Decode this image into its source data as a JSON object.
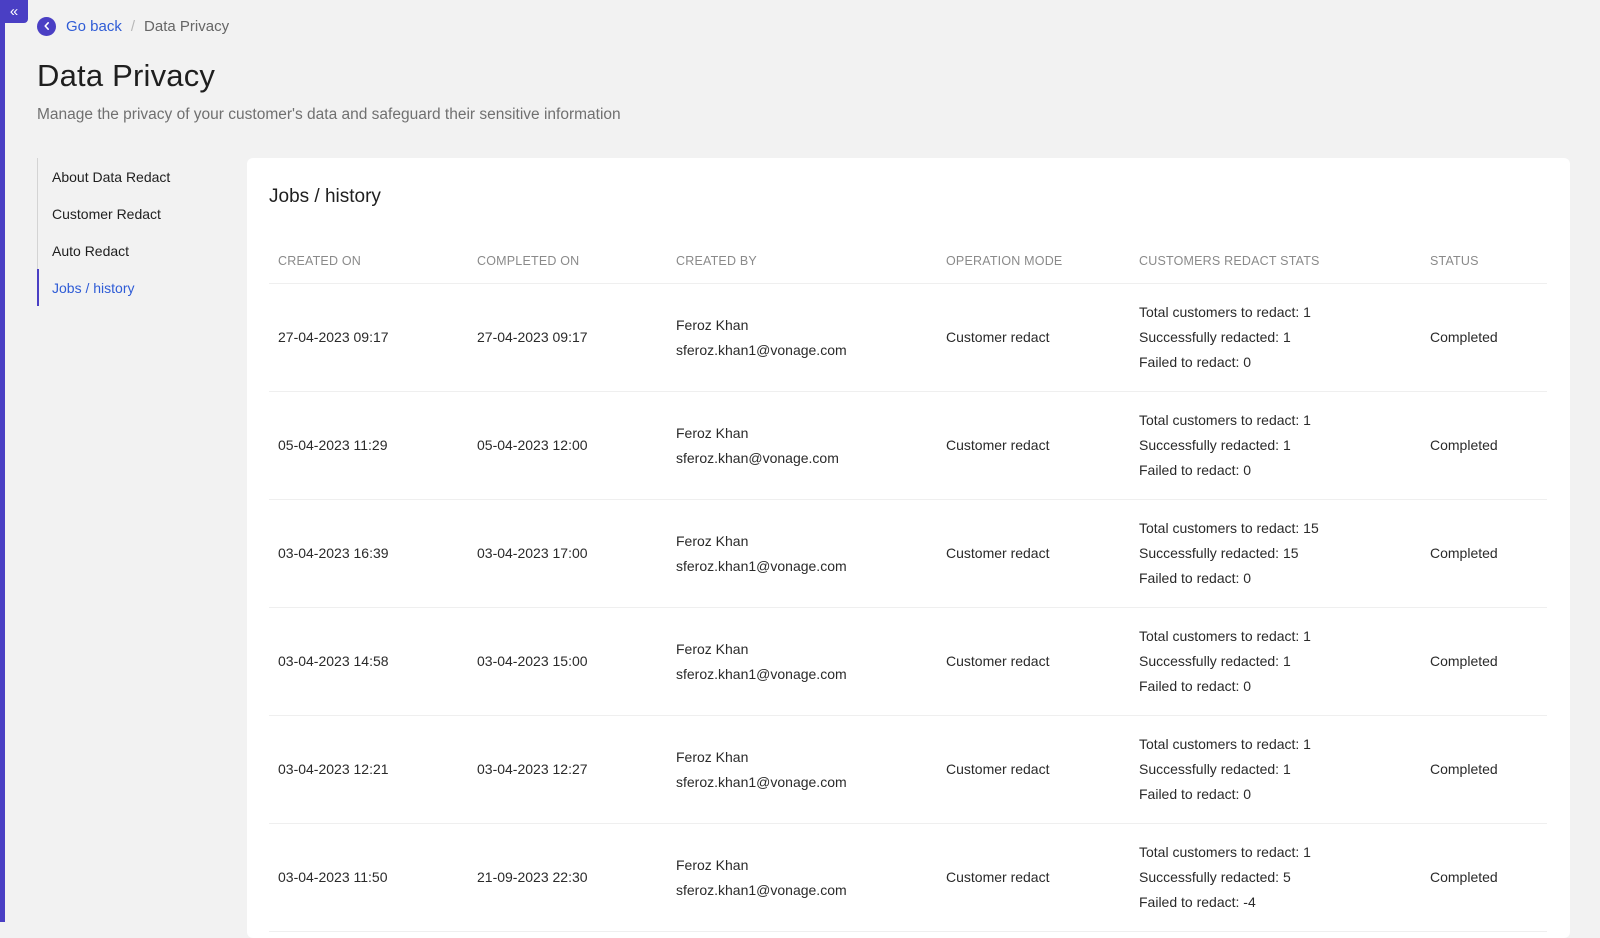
{
  "app": {
    "colors": {
      "accent": "#4a3fc4",
      "link": "#2f5cd6",
      "background": "#f2f2f2",
      "card": "#ffffff"
    },
    "collapse_icon": "double-chevron-left-icon"
  },
  "breadcrumb": {
    "back_label": "Go back",
    "back_icon": "chevron-left-icon",
    "separator": "/",
    "current": "Data Privacy"
  },
  "header": {
    "title": "Data Privacy",
    "subtitle": "Manage the privacy of your customer's data and safeguard their sensitive information"
  },
  "sidebar": {
    "items": [
      {
        "label": "About Data Redact",
        "active": false
      },
      {
        "label": "Customer Redact",
        "active": false
      },
      {
        "label": "Auto Redact",
        "active": false
      },
      {
        "label": "Jobs / history",
        "active": true
      }
    ]
  },
  "main": {
    "title": "Jobs / history",
    "columns": [
      "CREATED ON",
      "COMPLETED ON",
      "CREATED BY",
      "OPERATION MODE",
      "CUSTOMERS REDACT STATS",
      "STATUS"
    ],
    "rows": [
      {
        "created_on": "27-04-2023 09:17",
        "completed_on": "27-04-2023 09:17",
        "created_by_name": "Feroz Khan",
        "created_by_email": "sferoz.khan1@vonage.com",
        "operation_mode": "Customer redact",
        "stats_total": "Total customers to redact: 1",
        "stats_success": "Successfully redacted: 1",
        "stats_failed": "Failed to redact: 0",
        "status": "Completed"
      },
      {
        "created_on": "05-04-2023 11:29",
        "completed_on": "05-04-2023 12:00",
        "created_by_name": "Feroz Khan",
        "created_by_email": "sferoz.khan@vonage.com",
        "operation_mode": "Customer redact",
        "stats_total": "Total customers to redact: 1",
        "stats_success": "Successfully redacted: 1",
        "stats_failed": "Failed to redact: 0",
        "status": "Completed"
      },
      {
        "created_on": "03-04-2023 16:39",
        "completed_on": "03-04-2023 17:00",
        "created_by_name": "Feroz Khan",
        "created_by_email": "sferoz.khan1@vonage.com",
        "operation_mode": "Customer redact",
        "stats_total": "Total customers to redact: 15",
        "stats_success": "Successfully redacted: 15",
        "stats_failed": "Failed to redact: 0",
        "status": "Completed"
      },
      {
        "created_on": "03-04-2023 14:58",
        "completed_on": "03-04-2023 15:00",
        "created_by_name": "Feroz Khan",
        "created_by_email": "sferoz.khan1@vonage.com",
        "operation_mode": "Customer redact",
        "stats_total": "Total customers to redact: 1",
        "stats_success": "Successfully redacted: 1",
        "stats_failed": "Failed to redact: 0",
        "status": "Completed"
      },
      {
        "created_on": "03-04-2023 12:21",
        "completed_on": "03-04-2023 12:27",
        "created_by_name": "Feroz Khan",
        "created_by_email": "sferoz.khan1@vonage.com",
        "operation_mode": "Customer redact",
        "stats_total": "Total customers to redact: 1",
        "stats_success": "Successfully redacted: 1",
        "stats_failed": "Failed to redact: 0",
        "status": "Completed"
      },
      {
        "created_on": "03-04-2023 11:50",
        "completed_on": "21-09-2023 22:30",
        "created_by_name": "Feroz Khan",
        "created_by_email": "sferoz.khan1@vonage.com",
        "operation_mode": "Customer redact",
        "stats_total": "Total customers to redact: 1",
        "stats_success": "Successfully redacted: 5",
        "stats_failed": "Failed to redact: -4",
        "status": "Completed"
      }
    ]
  }
}
